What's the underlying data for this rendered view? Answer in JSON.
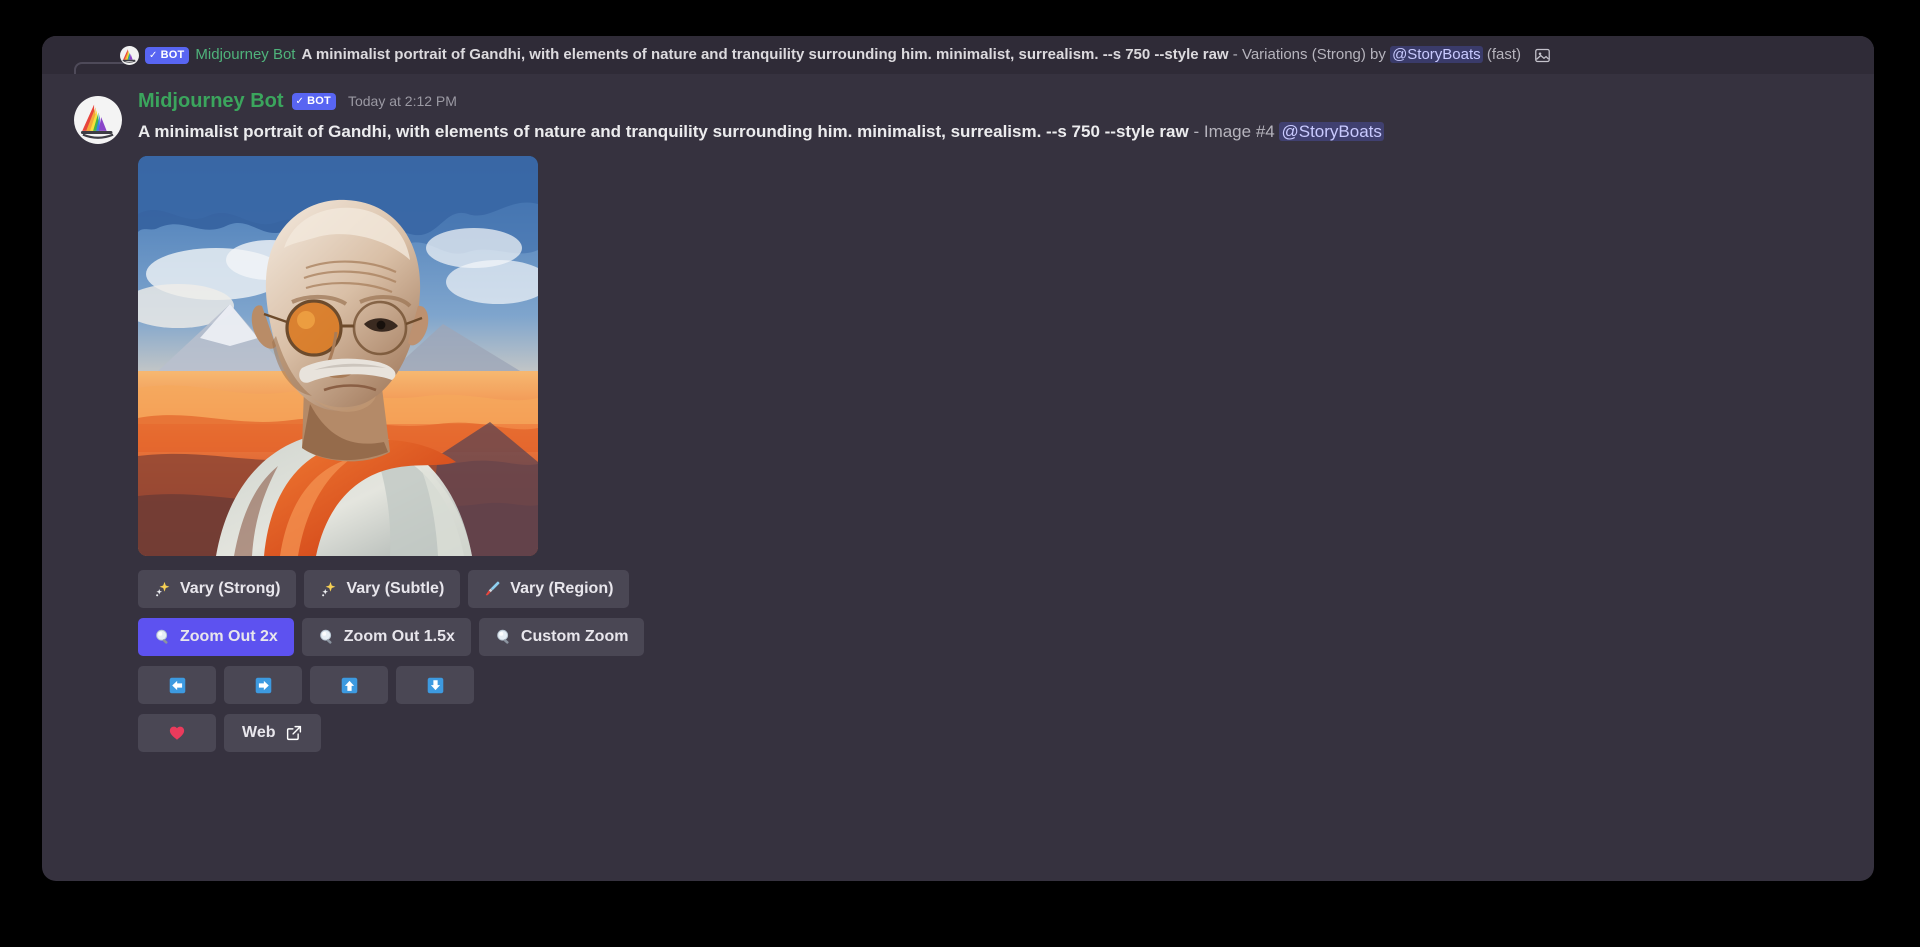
{
  "theme": {
    "page_background": "#000000",
    "card_background": "#36323f",
    "reply_bar_background": "#2f2b37",
    "bot_badge_color": "#5865F2",
    "author_name_color": "#3ba55d",
    "mention_color": "#c9caff",
    "button_background": "#4a4754",
    "button_primary_background": "#5d52f0"
  },
  "reply": {
    "avatar_icon": "midjourney-sailboat-avatar",
    "bot_badge": {
      "check": "✓",
      "label": "BOT"
    },
    "author": "Midjourney Bot",
    "prompt": "A minimalist portrait of Gandhi, with elements of nature and tranquility surrounding him. minimalist, surrealism. --s 750 --style raw",
    "separator": " - ",
    "action": "Variations (Strong) by",
    "mention": "@StoryBoats",
    "speed": "(fast)",
    "attachment_icon": "image-attachment-icon"
  },
  "message": {
    "avatar_icon": "midjourney-sailboat-avatar",
    "author": "Midjourney Bot",
    "bot_badge": {
      "check": "✓",
      "label": "BOT"
    },
    "timestamp": "Today at 2:12 PM",
    "prompt": "A minimalist portrait of Gandhi, with elements of nature and tranquility surrounding him. minimalist, surrealism. --s 750 --style raw",
    "separator": " - ",
    "image_label": "Image #4",
    "mention": "@StoryBoats"
  },
  "attachment": {
    "alt": "AI generated minimalist surreal portrait of Gandhi with mountains and sunset sky"
  },
  "buttons": {
    "row1": [
      {
        "emoji": "sparkles-icon",
        "label": "Vary (Strong)",
        "style": "secondary"
      },
      {
        "emoji": "sparkles-icon",
        "label": "Vary (Subtle)",
        "style": "secondary"
      },
      {
        "emoji": "paintbrush-icon",
        "label": "Vary (Region)",
        "style": "secondary"
      }
    ],
    "row2": [
      {
        "emoji": "magnifier-icon",
        "label": "Zoom Out 2x",
        "style": "primary"
      },
      {
        "emoji": "magnifier-icon",
        "label": "Zoom Out 1.5x",
        "style": "secondary"
      },
      {
        "emoji": "magnifier-icon",
        "label": "Custom Zoom",
        "style": "secondary"
      }
    ],
    "row3": [
      {
        "emoji": "arrow-left-icon",
        "label": "",
        "style": "secondary"
      },
      {
        "emoji": "arrow-right-icon",
        "label": "",
        "style": "secondary"
      },
      {
        "emoji": "arrow-up-icon",
        "label": "",
        "style": "secondary"
      },
      {
        "emoji": "arrow-down-icon",
        "label": "",
        "style": "secondary"
      }
    ],
    "row4": [
      {
        "emoji": "heart-icon",
        "label": "",
        "style": "secondary"
      },
      {
        "emoji": "",
        "label": "Web",
        "style": "secondary",
        "trailing_icon": "external-link-icon"
      }
    ]
  }
}
